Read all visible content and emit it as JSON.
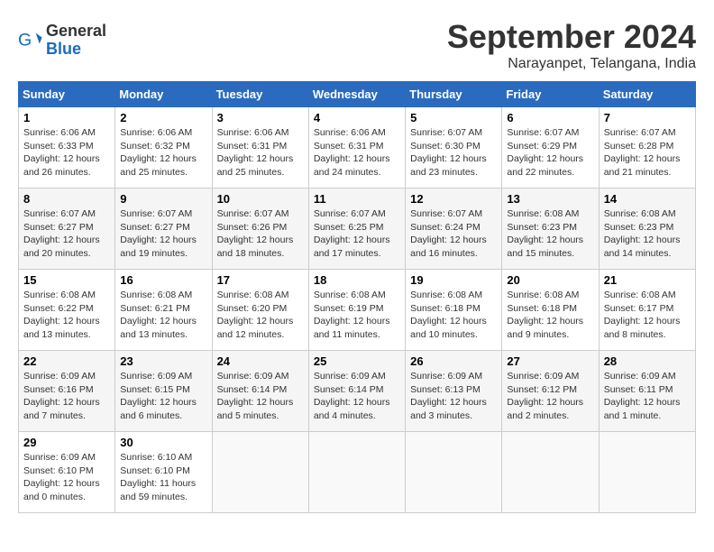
{
  "logo": {
    "general": "General",
    "blue": "Blue"
  },
  "title": "September 2024",
  "location": "Narayanpet, Telangana, India",
  "weekdays": [
    "Sunday",
    "Monday",
    "Tuesday",
    "Wednesday",
    "Thursday",
    "Friday",
    "Saturday"
  ],
  "weeks": [
    [
      {
        "day": 1,
        "sunrise": "6:06 AM",
        "sunset": "6:33 PM",
        "daylight": "12 hours and 26 minutes."
      },
      {
        "day": 2,
        "sunrise": "6:06 AM",
        "sunset": "6:32 PM",
        "daylight": "12 hours and 25 minutes."
      },
      {
        "day": 3,
        "sunrise": "6:06 AM",
        "sunset": "6:31 PM",
        "daylight": "12 hours and 25 minutes."
      },
      {
        "day": 4,
        "sunrise": "6:06 AM",
        "sunset": "6:31 PM",
        "daylight": "12 hours and 24 minutes."
      },
      {
        "day": 5,
        "sunrise": "6:07 AM",
        "sunset": "6:30 PM",
        "daylight": "12 hours and 23 minutes."
      },
      {
        "day": 6,
        "sunrise": "6:07 AM",
        "sunset": "6:29 PM",
        "daylight": "12 hours and 22 minutes."
      },
      {
        "day": 7,
        "sunrise": "6:07 AM",
        "sunset": "6:28 PM",
        "daylight": "12 hours and 21 minutes."
      }
    ],
    [
      {
        "day": 8,
        "sunrise": "6:07 AM",
        "sunset": "6:27 PM",
        "daylight": "12 hours and 20 minutes."
      },
      {
        "day": 9,
        "sunrise": "6:07 AM",
        "sunset": "6:27 PM",
        "daylight": "12 hours and 19 minutes."
      },
      {
        "day": 10,
        "sunrise": "6:07 AM",
        "sunset": "6:26 PM",
        "daylight": "12 hours and 18 minutes."
      },
      {
        "day": 11,
        "sunrise": "6:07 AM",
        "sunset": "6:25 PM",
        "daylight": "12 hours and 17 minutes."
      },
      {
        "day": 12,
        "sunrise": "6:07 AM",
        "sunset": "6:24 PM",
        "daylight": "12 hours and 16 minutes."
      },
      {
        "day": 13,
        "sunrise": "6:08 AM",
        "sunset": "6:23 PM",
        "daylight": "12 hours and 15 minutes."
      },
      {
        "day": 14,
        "sunrise": "6:08 AM",
        "sunset": "6:23 PM",
        "daylight": "12 hours and 14 minutes."
      }
    ],
    [
      {
        "day": 15,
        "sunrise": "6:08 AM",
        "sunset": "6:22 PM",
        "daylight": "12 hours and 13 minutes."
      },
      {
        "day": 16,
        "sunrise": "6:08 AM",
        "sunset": "6:21 PM",
        "daylight": "12 hours and 13 minutes."
      },
      {
        "day": 17,
        "sunrise": "6:08 AM",
        "sunset": "6:20 PM",
        "daylight": "12 hours and 12 minutes."
      },
      {
        "day": 18,
        "sunrise": "6:08 AM",
        "sunset": "6:19 PM",
        "daylight": "12 hours and 11 minutes."
      },
      {
        "day": 19,
        "sunrise": "6:08 AM",
        "sunset": "6:18 PM",
        "daylight": "12 hours and 10 minutes."
      },
      {
        "day": 20,
        "sunrise": "6:08 AM",
        "sunset": "6:18 PM",
        "daylight": "12 hours and 9 minutes."
      },
      {
        "day": 21,
        "sunrise": "6:08 AM",
        "sunset": "6:17 PM",
        "daylight": "12 hours and 8 minutes."
      }
    ],
    [
      {
        "day": 22,
        "sunrise": "6:09 AM",
        "sunset": "6:16 PM",
        "daylight": "12 hours and 7 minutes."
      },
      {
        "day": 23,
        "sunrise": "6:09 AM",
        "sunset": "6:15 PM",
        "daylight": "12 hours and 6 minutes."
      },
      {
        "day": 24,
        "sunrise": "6:09 AM",
        "sunset": "6:14 PM",
        "daylight": "12 hours and 5 minutes."
      },
      {
        "day": 25,
        "sunrise": "6:09 AM",
        "sunset": "6:14 PM",
        "daylight": "12 hours and 4 minutes."
      },
      {
        "day": 26,
        "sunrise": "6:09 AM",
        "sunset": "6:13 PM",
        "daylight": "12 hours and 3 minutes."
      },
      {
        "day": 27,
        "sunrise": "6:09 AM",
        "sunset": "6:12 PM",
        "daylight": "12 hours and 2 minutes."
      },
      {
        "day": 28,
        "sunrise": "6:09 AM",
        "sunset": "6:11 PM",
        "daylight": "12 hours and 1 minute."
      }
    ],
    [
      {
        "day": 29,
        "sunrise": "6:09 AM",
        "sunset": "6:10 PM",
        "daylight": "12 hours and 0 minutes."
      },
      {
        "day": 30,
        "sunrise": "6:10 AM",
        "sunset": "6:10 PM",
        "daylight": "11 hours and 59 minutes."
      },
      null,
      null,
      null,
      null,
      null
    ]
  ]
}
